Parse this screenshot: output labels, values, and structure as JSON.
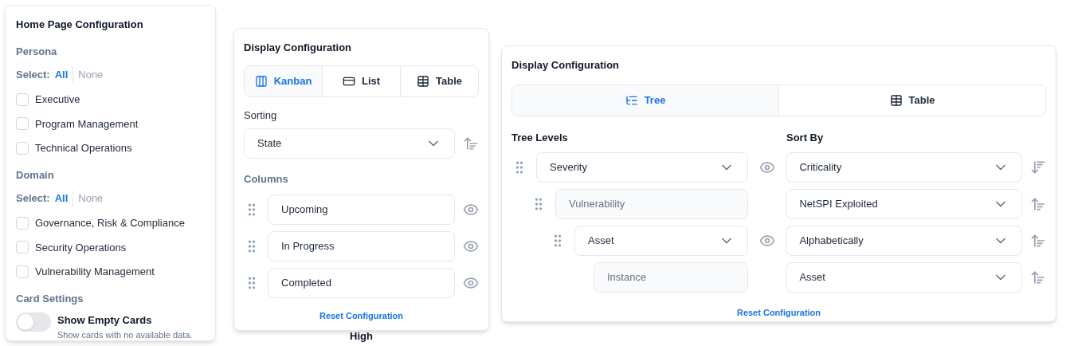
{
  "home_config": {
    "title": "Home Page Configuration",
    "sections": [
      {
        "heading": "Persona",
        "select_label": "Select:",
        "all_label": "All",
        "none_label": "None",
        "items": [
          {
            "label": "Executive",
            "checked": false
          },
          {
            "label": "Program Management",
            "checked": false
          },
          {
            "label": "Technical Operations",
            "checked": false
          }
        ]
      },
      {
        "heading": "Domain",
        "select_label": "Select:",
        "all_label": "All",
        "none_label": "None",
        "items": [
          {
            "label": "Governance, Risk & Compliance",
            "checked": false
          },
          {
            "label": "Security Operations",
            "checked": false
          },
          {
            "label": "Vulnerability Management",
            "checked": false
          }
        ]
      }
    ],
    "card_settings": {
      "heading": "Card Settings",
      "toggle": {
        "label": "Show Empty Cards",
        "description": "Show cards with no available data.",
        "on": false
      }
    }
  },
  "kanban_config": {
    "title": "Display Configuration",
    "tabs": [
      {
        "label": "Kanban",
        "kind": "kanban",
        "selected": true
      },
      {
        "label": "List",
        "kind": "list",
        "selected": false
      },
      {
        "label": "Table",
        "kind": "table",
        "selected": false
      }
    ],
    "sorting": {
      "label": "Sorting",
      "value": "State",
      "descending": false
    },
    "columns_label": "Columns",
    "columns": [
      {
        "name": "Upcoming"
      },
      {
        "name": "In Progress"
      },
      {
        "name": "Completed"
      }
    ],
    "reset": "Reset Configuration"
  },
  "background_text": "High",
  "tree_config": {
    "title": "Display Configuration",
    "tabs": [
      {
        "label": "Tree",
        "kind": "tree",
        "selected": true
      },
      {
        "label": "Table",
        "kind": "table",
        "selected": false
      }
    ],
    "levels_label": "Tree Levels",
    "sort_label": "Sort By",
    "levels": [
      {
        "label": "Severity",
        "disabled": false,
        "draggable": true,
        "sort": "Criticality",
        "descending": true,
        "children": [
          {
            "label": "Vulnerability",
            "disabled": true,
            "draggable": true,
            "sort": "NetSPI Exploited",
            "descending": false,
            "children": [
              {
                "label": "Asset",
                "disabled": false,
                "draggable": true,
                "sort": "Alphabetically",
                "descending": false,
                "children": [
                  {
                    "label": "Instance",
                    "disabled": true,
                    "draggable": false,
                    "sort": "Asset",
                    "descending": false
                  }
                ]
              }
            ]
          }
        ]
      }
    ],
    "reset": "Reset Configuration"
  }
}
